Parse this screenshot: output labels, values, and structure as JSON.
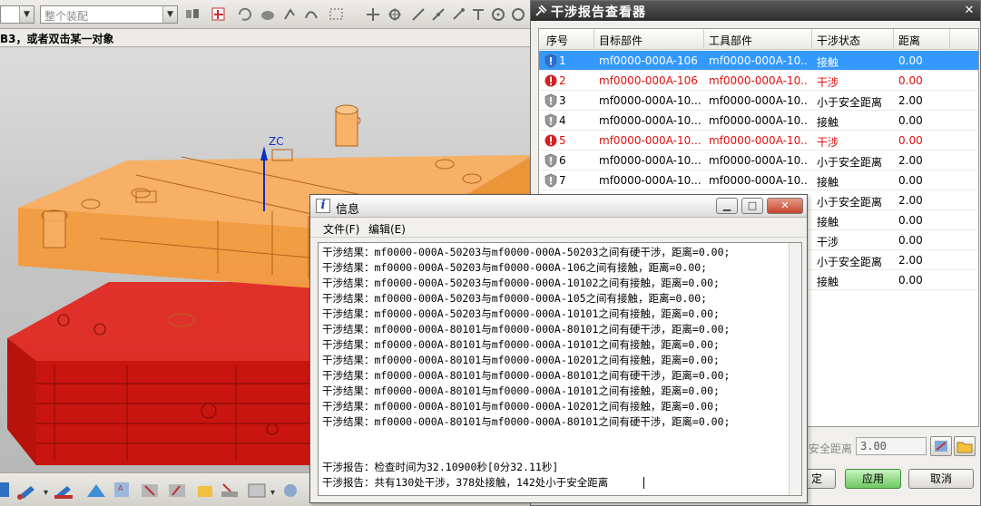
{
  "toolbar": {
    "filter_selected": "整个装配"
  },
  "cue_line": "B3，或者双击某一对象",
  "viewport": {
    "axis_label": "ZC"
  },
  "viewer": {
    "title": "干涉报告查看器",
    "columns": [
      "序号",
      "目标部件",
      "工具部件",
      "干涉状态",
      "距离"
    ],
    "rows": [
      {
        "id": "1",
        "target": "mf0000-000A-106",
        "tool": "mf0000-000A-10...",
        "status": "接触",
        "dist": "0.00",
        "severity": "contact",
        "selected": true
      },
      {
        "id": "2",
        "target": "mf0000-000A-106",
        "tool": "mf0000-000A-10...",
        "status": "干涉",
        "dist": "0.00",
        "severity": "clash",
        "selected": false
      },
      {
        "id": "3",
        "target": "mf0000-000A-10...",
        "tool": "mf0000-000A-10...",
        "status": "小于安全距离",
        "dist": "2.00",
        "severity": "contact",
        "selected": false
      },
      {
        "id": "4",
        "target": "mf0000-000A-10...",
        "tool": "mf0000-000A-10...",
        "status": "接触",
        "dist": "0.00",
        "severity": "contact",
        "selected": false
      },
      {
        "id": "5",
        "target": "mf0000-000A-10...",
        "tool": "mf0000-000A-10...",
        "status": "干涉",
        "dist": "0.00",
        "severity": "clash",
        "selected": false
      },
      {
        "id": "6",
        "target": "mf0000-000A-10...",
        "tool": "mf0000-000A-10...",
        "status": "小于安全距离",
        "dist": "2.00",
        "severity": "contact",
        "selected": false
      },
      {
        "id": "7",
        "target": "mf0000-000A-10...",
        "tool": "mf0000-000A-10...",
        "status": "接触",
        "dist": "0.00",
        "severity": "contact",
        "selected": false
      },
      {
        "id": "",
        "target": "",
        "tool": "",
        "status": "小于安全距离",
        "dist": "2.00",
        "severity": "",
        "selected": false
      },
      {
        "id": "",
        "target": "",
        "tool": "",
        "status": "接触",
        "dist": "0.00",
        "severity": "",
        "selected": false
      },
      {
        "id": "",
        "target": "",
        "tool": "",
        "status": "干涉",
        "dist": "0.00",
        "severity": "",
        "selected": false
      },
      {
        "id": "",
        "target": "",
        "tool": "",
        "status": "小于安全距离",
        "dist": "2.00",
        "severity": "",
        "selected": false
      },
      {
        "id": "",
        "target": "",
        "tool": "",
        "status": "接触",
        "dist": "0.00",
        "severity": "",
        "selected": false
      }
    ],
    "safe_distance_label": "安全距离",
    "safe_distance_value": "3.00",
    "ok_label": "定",
    "apply_label": "应用",
    "cancel_label": "取消"
  },
  "info": {
    "title": "信息",
    "menu_file": "文件(F)",
    "menu_edit": "编辑(E)",
    "lines": [
      "干涉结果：mf0000-000A-50203与mf0000-000A-50203之间有硬干涉，距离=0.00;",
      "干涉结果：mf0000-000A-50203与mf0000-000A-106之间有接触，距离=0.00;",
      "干涉结果：mf0000-000A-50203与mf0000-000A-10102之间有接触，距离=0.00;",
      "干涉结果：mf0000-000A-50203与mf0000-000A-105之间有接触，距离=0.00;",
      "干涉结果：mf0000-000A-50203与mf0000-000A-10101之间有接触，距离=0.00;",
      "干涉结果：mf0000-000A-80101与mf0000-000A-80101之间有硬干涉，距离=0.00;",
      "干涉结果：mf0000-000A-80101与mf0000-000A-10101之间有接触，距离=0.00;",
      "干涉结果：mf0000-000A-80101与mf0000-000A-10201之间有接触，距离=0.00;",
      "干涉结果：mf0000-000A-80101与mf0000-000A-80101之间有硬干涉，距离=0.00;",
      "干涉结果：mf0000-000A-80101与mf0000-000A-10101之间有接触，距离=0.00;",
      "干涉结果：mf0000-000A-80101与mf0000-000A-10201之间有接触，距离=0.00;",
      "干涉结果：mf0000-000A-80101与mf0000-000A-80101之间有硬干涉，距离=0.00;"
    ],
    "report_time": "干涉报告：检查时间为32.10900秒[0分32.11秒]",
    "report_summary": "干涉报告：共有130处干涉，378处接触，142处小于安全距离"
  },
  "colors": {
    "selection": "#3399ff",
    "clash_text": "#e01010",
    "cover_plate": "#f6a550",
    "base_plate": "#e21b14"
  }
}
